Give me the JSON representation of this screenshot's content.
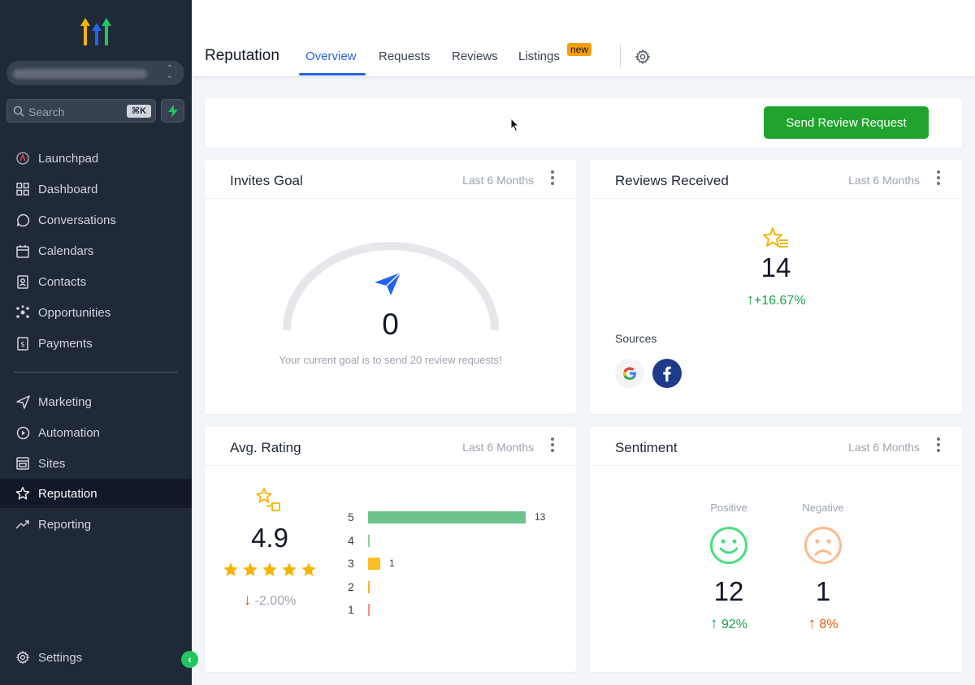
{
  "sidebar": {
    "search_placeholder": "Search",
    "search_shortcut": "⌘K",
    "items": [
      {
        "label": "Launchpad",
        "icon": "rocket-icon"
      },
      {
        "label": "Dashboard",
        "icon": "grid-icon"
      },
      {
        "label": "Conversations",
        "icon": "chat-icon"
      },
      {
        "label": "Calendars",
        "icon": "calendar-icon"
      },
      {
        "label": "Contacts",
        "icon": "contacts-icon"
      },
      {
        "label": "Opportunities",
        "icon": "network-icon"
      },
      {
        "label": "Payments",
        "icon": "payments-icon"
      },
      {
        "label": "Marketing",
        "icon": "send-icon"
      },
      {
        "label": "Automation",
        "icon": "automation-icon"
      },
      {
        "label": "Sites",
        "icon": "sites-icon"
      },
      {
        "label": "Reputation",
        "icon": "star-icon",
        "active": true
      },
      {
        "label": "Reporting",
        "icon": "trend-icon"
      }
    ],
    "settings_label": "Settings"
  },
  "header": {
    "title": "Reputation",
    "tabs": [
      {
        "label": "Overview",
        "active": true
      },
      {
        "label": "Requests"
      },
      {
        "label": "Reviews"
      },
      {
        "label": "Listings"
      }
    ],
    "new_badge": "new"
  },
  "actions": {
    "send_review_request": "Send Review Request"
  },
  "invites_goal": {
    "title": "Invites Goal",
    "period": "Last 6 Months",
    "value": "0",
    "caption": "Your current goal is to send 20 review requests!"
  },
  "reviews_received": {
    "title": "Reviews Received",
    "period": "Last 6 Months",
    "value": "14",
    "change": "+16.67%",
    "sources_label": "Sources",
    "sources": [
      "google",
      "facebook"
    ]
  },
  "avg_rating": {
    "title": "Avg. Rating",
    "period": "Last 6 Months",
    "value": "4.9",
    "change": "-2.00%",
    "stars": 5,
    "breakdown": [
      {
        "star": "5",
        "count": 13,
        "label": "13",
        "color": "#6cc38c"
      },
      {
        "star": "4",
        "count": 0,
        "label": "",
        "color": "#6cc38c"
      },
      {
        "star": "3",
        "count": 1,
        "label": "1",
        "color": "#fbbf24"
      },
      {
        "star": "2",
        "count": 0,
        "label": "",
        "color": "#f59e0b"
      },
      {
        "star": "1",
        "count": 0,
        "label": "",
        "color": "#f87171"
      }
    ]
  },
  "sentiment": {
    "title": "Sentiment",
    "period": "Last 6 Months",
    "positive": {
      "label": "Positive",
      "value": "12",
      "change": "92%"
    },
    "negative": {
      "label": "Negative",
      "value": "1",
      "change": "8%"
    }
  },
  "colors": {
    "brand_green": "#1fa32c",
    "accent_blue": "#2563eb",
    "sidebar_bg": "#1f2937"
  }
}
